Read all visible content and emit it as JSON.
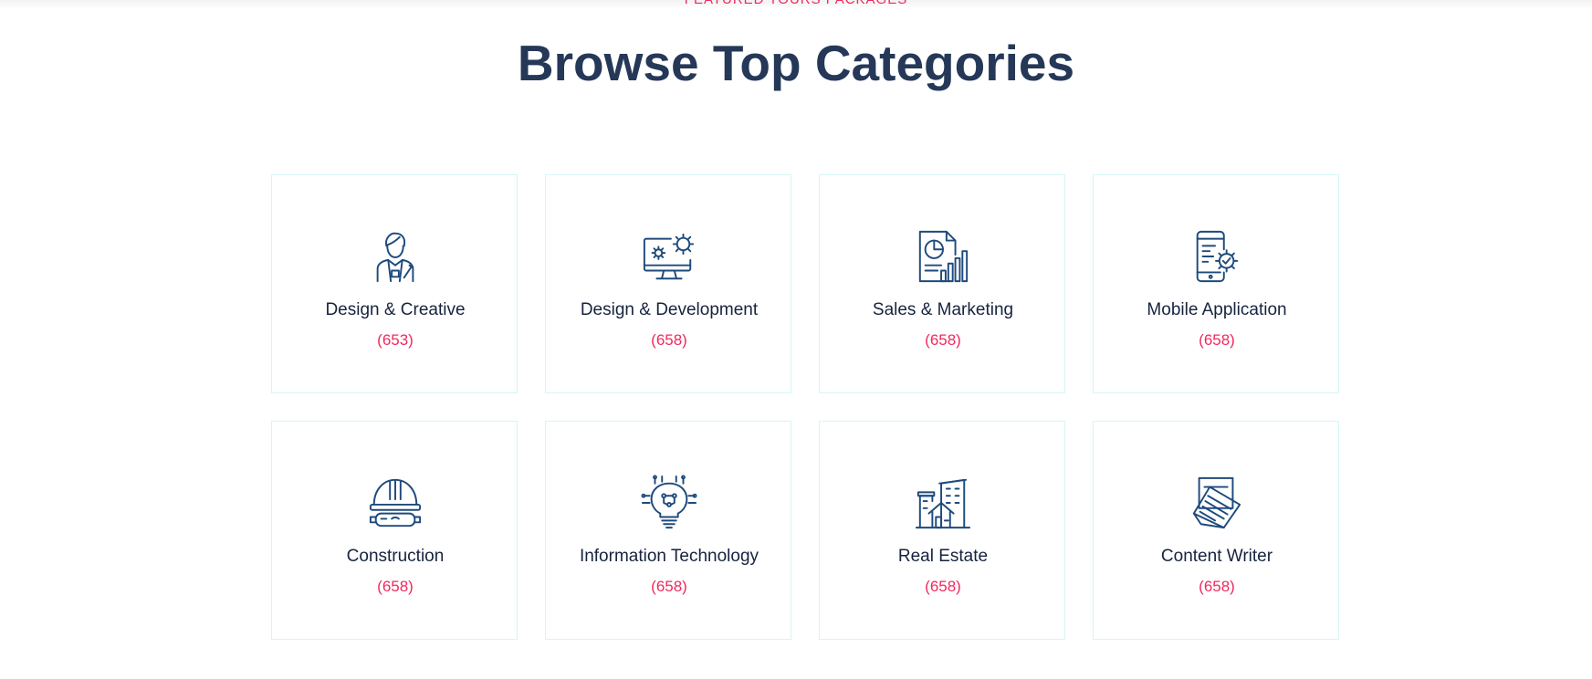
{
  "section": {
    "eyebrow": "FEATURED TOURS PACKAGES",
    "title": "Browse Top Categories"
  },
  "categories": [
    {
      "name": "Design & Creative",
      "count": "(653)",
      "icon": "designer-person-icon"
    },
    {
      "name": "Design & Development",
      "count": "(658)",
      "icon": "monitor-gears-icon"
    },
    {
      "name": "Sales & Marketing",
      "count": "(658)",
      "icon": "report-chart-icon"
    },
    {
      "name": "Mobile Application",
      "count": "(658)",
      "icon": "mobile-settings-icon"
    },
    {
      "name": "Construction",
      "count": "(658)",
      "icon": "helmet-goggles-icon"
    },
    {
      "name": "Information Technology",
      "count": "(658)",
      "icon": "circuit-bulb-icon"
    },
    {
      "name": "Real Estate",
      "count": "(658)",
      "icon": "buildings-icon"
    },
    {
      "name": "Content Writer",
      "count": "(658)",
      "icon": "documents-icon"
    }
  ],
  "colors": {
    "title": "#253858",
    "accent": "#f0295e",
    "icon": "#1e4a7c",
    "card_border": "#d4f6f6"
  }
}
